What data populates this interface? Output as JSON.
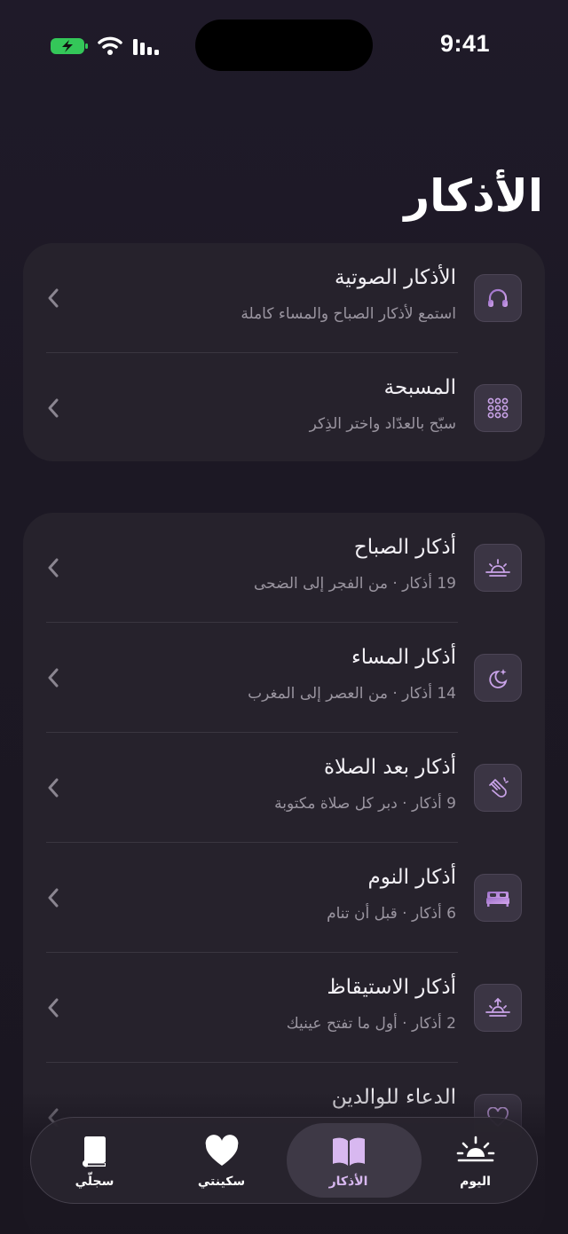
{
  "status_bar": {
    "time": "9:41"
  },
  "page": {
    "title": "الأذكار"
  },
  "tools": [
    {
      "title": "الأذكار الصوتية",
      "subtitle": "استمع لأذكار الصباح والمساء كاملة",
      "icon": "headphones-icon"
    },
    {
      "title": "المسبحة",
      "subtitle": "سبّح بالعدّاد واختر الذِكر",
      "icon": "counter-grid-icon"
    }
  ],
  "collections": [
    {
      "title": "أذكار الصباح",
      "subtitle": "19 أذكار · من الفجر إلى الضحى",
      "icon": "sunrise-icon"
    },
    {
      "title": "أذكار المساء",
      "subtitle": "14 أذكار · من العصر إلى المغرب",
      "icon": "moon-stars-icon"
    },
    {
      "title": "أذكار بعد الصلاة",
      "subtitle": "9 أذكار · دبر كل صلاة مكتوبة",
      "icon": "praying-hands-icon"
    },
    {
      "title": "أذكار النوم",
      "subtitle": "6 أذكار · قبل أن تنام",
      "icon": "bed-icon"
    },
    {
      "title": "أذكار الاستيقاظ",
      "subtitle": "2 أذكار · أول ما تفتح عينيك",
      "icon": "wake-sun-icon"
    },
    {
      "title": "الدعاء للوالدين",
      "subtitle": "",
      "icon": "heart-icon"
    }
  ],
  "tabbar": {
    "tabs": [
      {
        "label": "اليوم",
        "icon": "sun-horizon-icon"
      },
      {
        "label": "الأذكار",
        "icon": "open-book-icon",
        "active": true
      },
      {
        "label": "سكينتي",
        "icon": "heart-icon"
      },
      {
        "label": "سجلّي",
        "icon": "closed-book-icon"
      }
    ]
  },
  "colors": {
    "accent": "#c9a3e8",
    "background": "#1a1620",
    "card": "#26222c"
  }
}
